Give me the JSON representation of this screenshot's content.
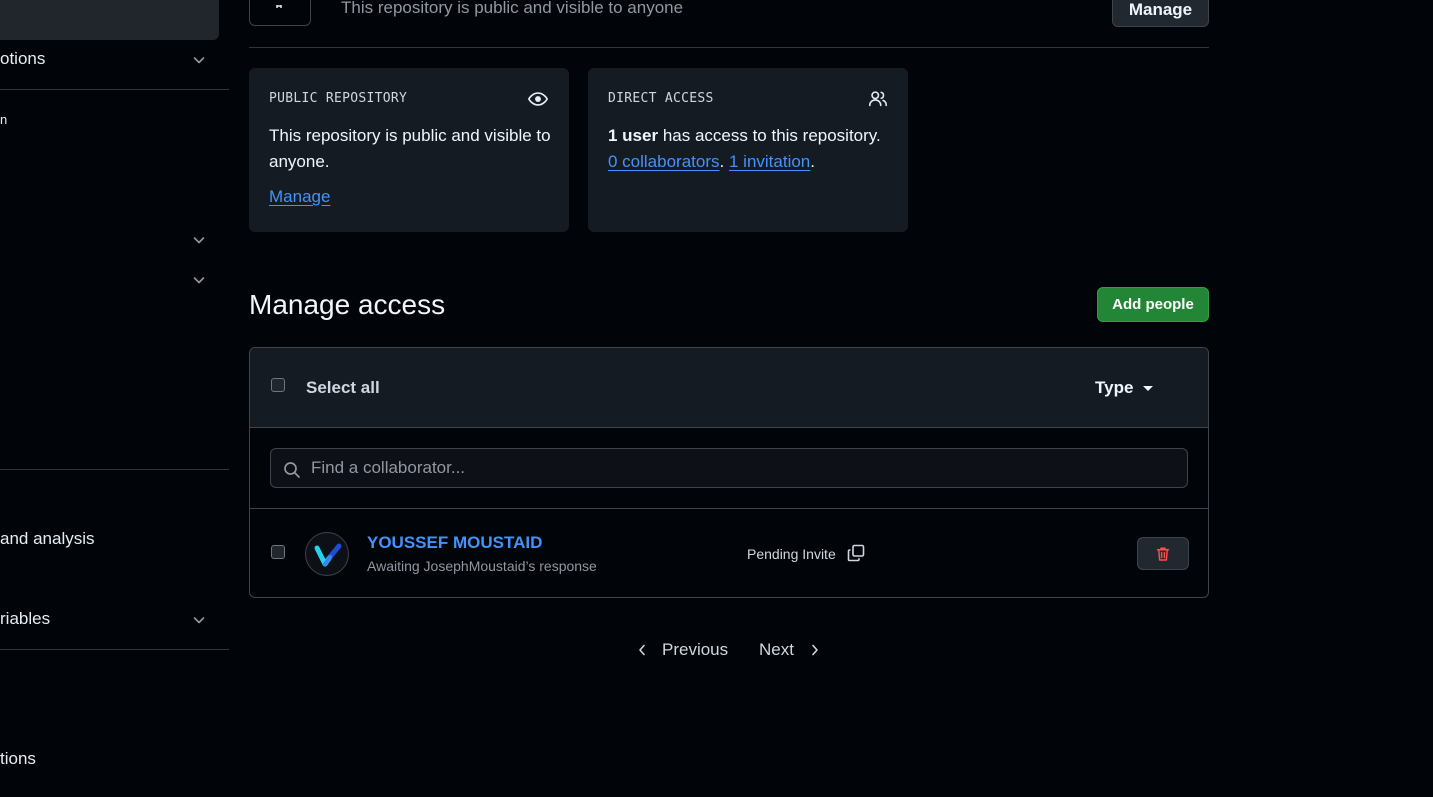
{
  "sidebar": {
    "items": [
      {
        "label": "otions"
      },
      {
        "label": "n"
      },
      {
        "label": "and analysis"
      },
      {
        "label": "riables"
      },
      {
        "label": "tions"
      }
    ]
  },
  "top": {
    "visibility_text": "This repository is public and visible to anyone",
    "manage_label": "Manage"
  },
  "cards": {
    "public": {
      "label": "PUBLIC REPOSITORY",
      "text": "This repository is public and visible to anyone.",
      "link": "Manage",
      "icon": "eye-icon"
    },
    "direct": {
      "label": "DIRECT ACCESS",
      "user_count": "1 user",
      "text_rest": " has access to this repository.",
      "collaborators_link": "0 collaborators",
      "separator": ".",
      "invitation_link": "1 invitation",
      "end": ".",
      "icon": "people-icon"
    }
  },
  "manage_access": {
    "title": "Manage access",
    "add_people_label": "Add people",
    "select_all_label": "Select all",
    "type_label": "Type",
    "search_placeholder": "Find a collaborator...",
    "rows": [
      {
        "name": "YOUSSEF MOUSTAID",
        "subtitle": "Awaiting JosephMoustaid’s response",
        "status": "Pending Invite"
      }
    ]
  },
  "pagination": {
    "previous": "Previous",
    "next": "Next"
  },
  "colors": {
    "accent": "#4493f8",
    "primary_button": "#238636",
    "danger": "#f85149",
    "background": "#010409",
    "card": "#151b23"
  }
}
